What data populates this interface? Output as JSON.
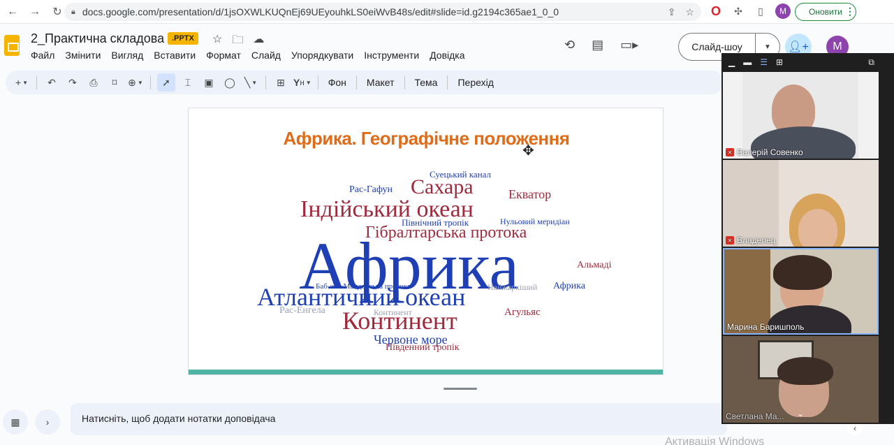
{
  "browser": {
    "url": "docs.google.com/presentation/d/1jsOXWLKUQnEj69UEyouhkLS0eiWvB48s/edit#slide=id.g2194c365ae1_0_0",
    "profile_initial": "M",
    "update_label": "Оновити"
  },
  "doc": {
    "title": "2_Практична складова",
    "badge": ".PPTX",
    "menu": [
      "Файл",
      "Змінити",
      "Вигляд",
      "Вставити",
      "Формат",
      "Слайд",
      "Упорядкувати",
      "Інструменти",
      "Довідка"
    ],
    "slideshow_label": "Слайд-шоу",
    "user_initial": "M"
  },
  "toolbar": {
    "background": "Фон",
    "layout": "Макет",
    "theme": "Тема",
    "transition": "Перехід"
  },
  "slide": {
    "title": "Африка. Географічне положення",
    "title_color": "#e06c1a",
    "bar_color": "#4fb3a6",
    "words": [
      "Африка",
      "Атлантичний океан",
      "Індійський океан",
      "Континент",
      "Сахара",
      "Гібралтарська протока",
      "Червоне море",
      "Екватор",
      "Рас-Гафун",
      "Суецький канал",
      "Південний тропік",
      "Північний тропік",
      "Нульовий меридіан",
      "Альмаді",
      "Агульяс",
      "Рас-Енгела",
      "Баб-ель-Мандебська протока",
      "Найжаркіший",
      "Континент",
      "Африка"
    ]
  },
  "notes": {
    "placeholder": "Натисніть, щоб додати нотатки доповідача"
  },
  "watermark": "Активація Windows",
  "meet": {
    "participants": [
      {
        "name": "Валерій Совенко",
        "muted": true
      },
      {
        "name": "Владелец",
        "muted": true
      },
      {
        "name": "Марина Баришполь",
        "muted": false
      },
      {
        "name": "Светлана Ма...",
        "muted": false
      }
    ]
  }
}
